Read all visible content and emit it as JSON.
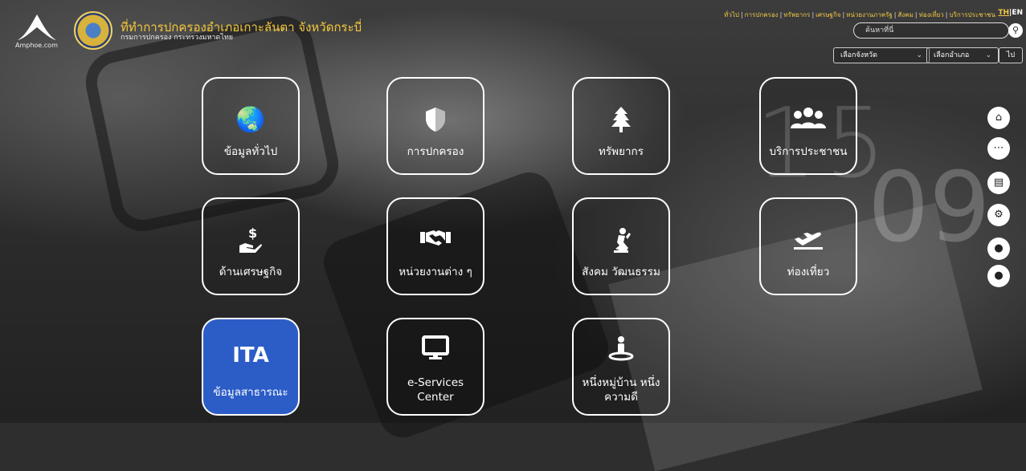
{
  "header": {
    "logo_text": "Amphoe.com",
    "title": "ที่ทำการปกครองอำเภอเกาะลันตา จังหวัดกระบี่",
    "subtitle": "กรมการปกครอง กระทรวงมหาดไทย"
  },
  "topnav": {
    "items": [
      "ทั่วไป",
      "การปกครอง",
      "ทรัพยากร",
      "เศรษฐกิจ",
      "หน่วยงานภาครัฐ",
      "สังคม",
      "ท่องเที่ยว",
      "บริการประชาชน"
    ],
    "lang_th": "TH",
    "lang_sep": "|",
    "lang_en": "EN"
  },
  "search": {
    "placeholder": "ค้นหาที่นี่",
    "button_icon": "search-icon"
  },
  "filters": {
    "province_placeholder": "เลือกจังหวัด",
    "district_placeholder": "เลือกอำเภอ",
    "go_label": "ไป"
  },
  "tiles": [
    {
      "label": "ข้อมูลทั่วไป",
      "icon": "globe-icon"
    },
    {
      "label": "การปกครอง",
      "icon": "shield-icon"
    },
    {
      "label": "ทรัพยากร",
      "icon": "tree-icon"
    },
    {
      "label": "บริการประชาชน",
      "icon": "people-icon"
    },
    {
      "label": "ด้านเศรษฐกิจ",
      "icon": "money-hand-icon"
    },
    {
      "label": "หน่วยงานต่าง ๆ",
      "icon": "handshake-icon"
    },
    {
      "label": "สังคม วัฒนธรรม",
      "icon": "praying-icon"
    },
    {
      "label": "ท่องเที่ยว",
      "icon": "plane-icon"
    },
    {
      "label": "ข้อมูลสาธารณะ",
      "big": "ITA",
      "color": "#2c5dc7"
    },
    {
      "label_line1": "e-Services",
      "label_line2": "Center",
      "icon": "monitor-icon"
    },
    {
      "label_line1": "หนึ่งหมู่บ้าน หนึ่ง",
      "label_line2": "ความดี",
      "icon": "person-pin-icon"
    }
  ],
  "rail": [
    "home-icon",
    "grid-icon",
    "news-icon",
    "map-icon",
    "user-icon",
    "user-icon"
  ],
  "background_text": {
    "clock1": "15",
    "clock2": "09"
  },
  "accent_color": "#f5c83b"
}
